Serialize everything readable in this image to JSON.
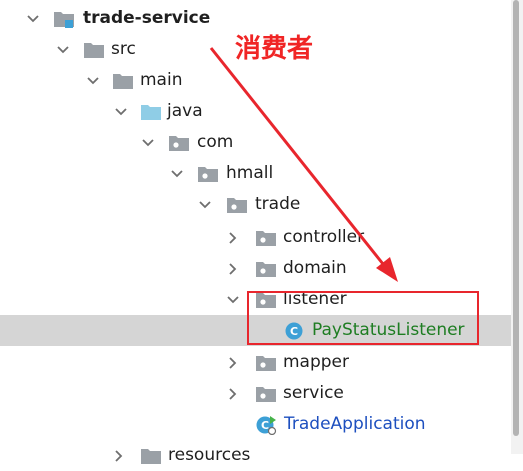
{
  "tree": {
    "nodes": [
      {
        "label": "trade-service",
        "icon": "module-folder-icon",
        "expanded": true
      },
      {
        "label": "src",
        "icon": "folder-icon",
        "expanded": true
      },
      {
        "label": "main",
        "icon": "folder-icon",
        "expanded": true
      },
      {
        "label": "java",
        "icon": "source-folder-icon",
        "expanded": true
      },
      {
        "label": "com",
        "icon": "package-icon",
        "expanded": true
      },
      {
        "label": "hmall",
        "icon": "package-icon",
        "expanded": true
      },
      {
        "label": "trade",
        "icon": "package-icon",
        "expanded": true
      },
      {
        "label": "controller",
        "icon": "package-icon",
        "expanded": false
      },
      {
        "label": "domain",
        "icon": "package-icon",
        "expanded": false
      },
      {
        "label": "listener",
        "icon": "package-icon",
        "expanded": true
      },
      {
        "label": "PayStatusListener",
        "icon": "class-icon",
        "selected": true
      },
      {
        "label": "mapper",
        "icon": "package-icon",
        "expanded": false
      },
      {
        "label": "service",
        "icon": "package-icon",
        "expanded": false
      },
      {
        "label": "TradeApplication",
        "icon": "spring-boot-class-icon"
      },
      {
        "label": "resources",
        "icon": "folder-icon",
        "expanded": false
      }
    ]
  },
  "annotation": {
    "text": "消费者",
    "color": "#f02525"
  },
  "colors": {
    "selection": "#d5d5d5",
    "class_text": "#1e7d22",
    "app_text": "#1d4fbf",
    "folder": "#9aa0a6",
    "source_folder": "#8fcde6",
    "class_icon": "#3da0d6"
  }
}
